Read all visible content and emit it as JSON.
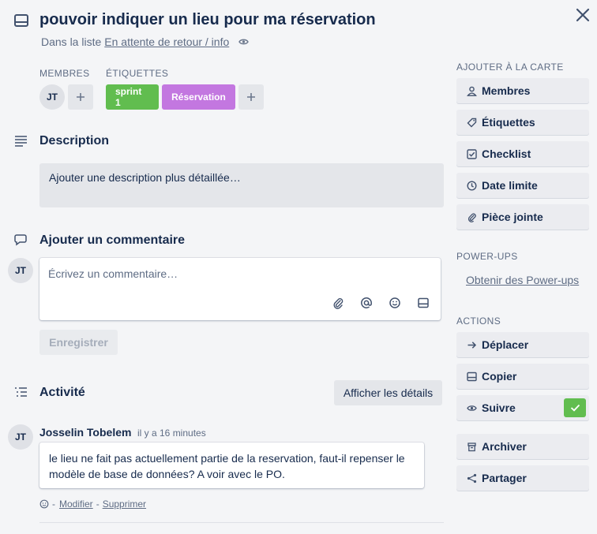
{
  "header": {
    "title": "pouvoir indiquer un lieu pour ma réservation",
    "list_prefix": "Dans la liste",
    "list_name": "En attente de retour / info"
  },
  "members": {
    "label": "Membres",
    "avatar": "JT",
    "add": "+"
  },
  "labels": {
    "label": "Étiquettes",
    "items": [
      {
        "text": "sprint 1",
        "color": "#61bd4f"
      },
      {
        "text": "Réservation",
        "color": "#c377e0"
      }
    ],
    "add": "+"
  },
  "description": {
    "heading": "Description",
    "placeholder": "Ajouter une description plus détaillée…"
  },
  "comment": {
    "heading": "Ajouter un commentaire",
    "avatar": "JT",
    "placeholder": "Écrivez un commentaire…",
    "save": "Enregistrer"
  },
  "activity": {
    "heading": "Activité",
    "details_button": "Afficher les détails",
    "entries": [
      {
        "avatar": "JT",
        "author": "Josselin Tobelem",
        "time": "il y a 16 minutes",
        "text": "le lieu ne fait pas actuellement partie de la reservation, faut-il repenser le modèle de base de données? A voir avec le PO.",
        "sep1": "-",
        "edit": "Modifier",
        "sep2": "-",
        "delete": "Supprimer"
      }
    ]
  },
  "sidebar": {
    "add_title": "Ajouter à la carte",
    "add_items": [
      {
        "label": "Membres",
        "icon": "person-icon"
      },
      {
        "label": "Étiquettes",
        "icon": "tag-icon"
      },
      {
        "label": "Checklist",
        "icon": "checkbox-icon"
      },
      {
        "label": "Date limite",
        "icon": "clock-icon"
      },
      {
        "label": "Pièce jointe",
        "icon": "paperclip-icon"
      }
    ],
    "powerups_title": "Power-Ups",
    "powerups_link": "Obtenir des Power-ups",
    "actions_title": "Actions",
    "actions": [
      {
        "label": "Déplacer",
        "icon": "arrow-right-icon"
      },
      {
        "label": "Copier",
        "icon": "card-icon"
      },
      {
        "label": "Suivre",
        "icon": "eye-icon"
      },
      {
        "label": "Archiver",
        "icon": "archive-icon"
      },
      {
        "label": "Partager",
        "icon": "share-icon"
      }
    ],
    "follow_check_color": "#61bd4f"
  }
}
